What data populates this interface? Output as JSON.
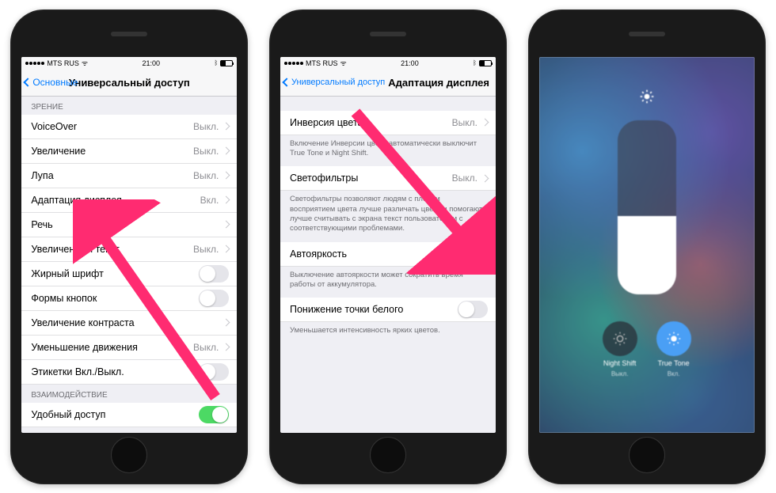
{
  "status": {
    "carrier": "MTS RUS",
    "wifi": "ᯤ",
    "time": "21:00",
    "bt": "✱"
  },
  "phone1": {
    "back": "Основные",
    "title": "Универсальный доступ",
    "sections": {
      "vision_header": "ЗРЕНИЕ",
      "interaction_header": "ВЗАИМОДЕЙСТВИЕ"
    },
    "rows": {
      "voiceover": {
        "label": "VoiceOver",
        "value": "Выкл."
      },
      "zoom": {
        "label": "Увеличение",
        "value": "Выкл."
      },
      "magnifier": {
        "label": "Лупа",
        "value": "Выкл."
      },
      "display": {
        "label": "Адаптация дисплея",
        "value": "Вкл."
      },
      "speech": {
        "label": "Речь",
        "value": ""
      },
      "larger_text": {
        "label": "Увеличенный текст",
        "value": "Выкл."
      },
      "bold_text": {
        "label": "Жирный шрифт"
      },
      "button_shapes": {
        "label": "Формы кнопок"
      },
      "contrast": {
        "label": "Увеличение контраста"
      },
      "reduce_motion": {
        "label": "Уменьшение движения",
        "value": "Выкл."
      },
      "labels": {
        "label": "Этикетки Вкл./Выкл."
      },
      "assistive": {
        "label": "Удобный доступ"
      }
    }
  },
  "phone2": {
    "back": "Универсальный доступ",
    "title": "Адаптация дисплея",
    "rows": {
      "invert": {
        "label": "Инверсия цвета",
        "value": "Выкл."
      },
      "filters": {
        "label": "Светофильтры",
        "value": "Выкл."
      },
      "auto_brightness": {
        "label": "Автояркость"
      },
      "white_point": {
        "label": "Понижение точки белого"
      }
    },
    "footers": {
      "invert": "Включение Инверсии цвета автоматически выключит True Tone и Night Shift.",
      "filters": "Светофильтры позволяют людям с плохим восприятием цвета лучше различать цвета и помогают лучше считывать с экрана текст пользователям с соответствующими проблемами.",
      "auto": "Выключение автояркости может сократить время работы от аккумулятора.",
      "white": "Уменьшается интенсивность ярких цветов."
    }
  },
  "phone3": {
    "night_shift": {
      "label": "Night Shift",
      "sub": "Выкл."
    },
    "true_tone": {
      "label": "True Tone",
      "sub": "Вкл."
    }
  }
}
